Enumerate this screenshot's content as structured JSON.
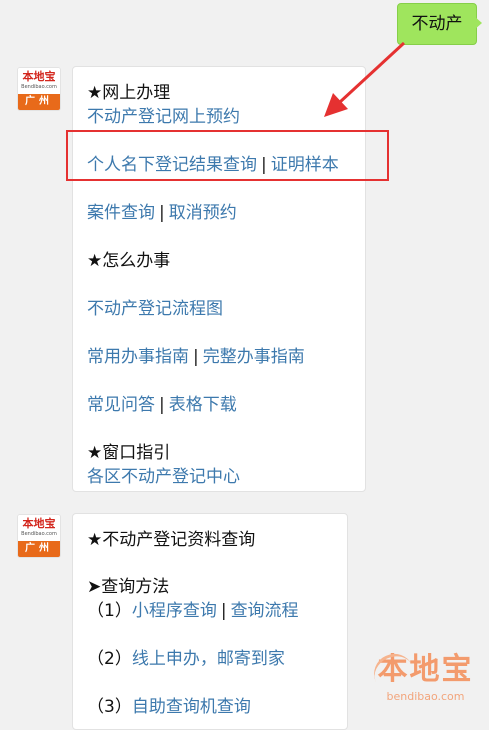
{
  "avatar": {
    "brand": "本地宝",
    "domain": "Bendibao.com",
    "city": "广州"
  },
  "reply_bubble": {
    "text": "不动产"
  },
  "message1": {
    "online": {
      "heading": "★网上办理",
      "link_appointment": "不动产登记网上预约",
      "link_query_result": "个人名下登记结果查询",
      "link_sample": "证明样本",
      "link_case_query": "案件查询",
      "link_cancel": "取消预约"
    },
    "howto": {
      "heading": "★怎么办事",
      "link_flowchart": "不动产登记流程图",
      "link_common_guide": "常用办事指南",
      "link_full_guide": "完整办事指南",
      "link_faq": "常见问答",
      "link_forms": "表格下载"
    },
    "window": {
      "heading": "★窗口指引",
      "link_centers": "各区不动产登记中心"
    },
    "separator": "|"
  },
  "message2": {
    "heading": "★不动产登记资料查询",
    "subheading": "➤查询方法",
    "items": [
      {
        "num": "（1）",
        "link_a": "小程序查询",
        "link_b": "查询流程"
      },
      {
        "num": "（2）",
        "link_a": "线上申办，邮寄到家"
      },
      {
        "num": "（3）",
        "link_a": "自助查询机查询"
      }
    ]
  },
  "watermark": {
    "title": "本地宝",
    "domain": "bendibao.com"
  },
  "colors": {
    "link": "#3d79ad",
    "highlight": "#e53131",
    "reply_bubble": "#9fe55d",
    "avatar_bar": "#e86a1a"
  }
}
